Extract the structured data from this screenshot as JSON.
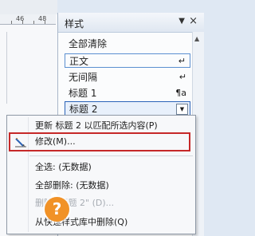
{
  "ruler": {
    "left_num": "46",
    "right_num": "48"
  },
  "styles_panel": {
    "title": "样式",
    "dropdown_glyph": "▼",
    "close_glyph": "×",
    "rows": [
      {
        "label": "全部清除",
        "mark": ""
      },
      {
        "label": "正文",
        "mark": "↵"
      },
      {
        "label": "无间隔",
        "mark": "↵"
      },
      {
        "label": "标题 1",
        "mark": "¶a"
      },
      {
        "label": "标题 2",
        "mark": "▼"
      }
    ]
  },
  "context_menu": {
    "items": [
      {
        "label": "更新 标题 2 以匹配所选内容(P)",
        "disabled": false
      },
      {
        "label": "修改(M)...",
        "disabled": false
      },
      {
        "label": "全选: (无数据)",
        "disabled": false
      },
      {
        "label": "全部删除: (无数据)",
        "disabled": false
      },
      {
        "label": "删除 \"标题 2\" (D)...",
        "disabled": true
      },
      {
        "label": "从快速样式库中删除(Q)",
        "disabled": false
      }
    ]
  },
  "watermark": {
    "glyph": "?"
  },
  "colors": {
    "highlight_border": "#c62828",
    "selection_border": "#2b63b8",
    "badge": "#f19227"
  }
}
